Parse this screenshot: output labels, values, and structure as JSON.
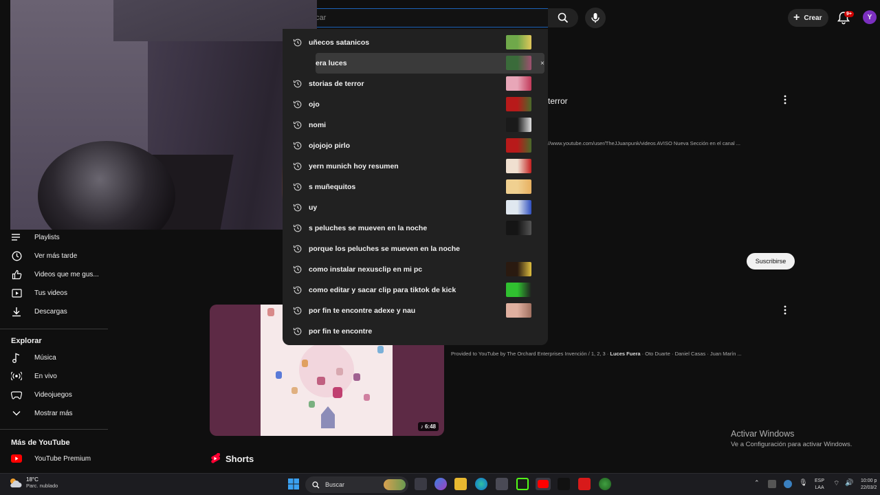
{
  "header": {
    "search_value": "car",
    "create_label": "Crear",
    "notif_badge": "9+",
    "avatar_letter": "Y"
  },
  "suggestions": [
    {
      "text": "uñecos satanicos",
      "thumb": [
        "#6fa84a",
        "#e0c75a"
      ]
    },
    {
      "text": "era luces",
      "thumb": [
        "#3a6b3a",
        "#a05070"
      ],
      "highlighted": true
    },
    {
      "text": "storias de terror",
      "thumb": [
        "#e8a6b8",
        "#c23a5a"
      ]
    },
    {
      "text": "ojo",
      "thumb": [
        "#b81a1a",
        "#4a6b2a"
      ]
    },
    {
      "text": "nomi",
      "thumb": [
        "#1a1a1a",
        "#e0e0e0"
      ]
    },
    {
      "text": "ojojojo pirlo",
      "thumb": [
        "#b81a1a",
        "#4a6b2a"
      ]
    },
    {
      "text": "yern munich hoy resumen",
      "thumb": [
        "#f0e0d0",
        "#c42020"
      ]
    },
    {
      "text": "s muñequitos",
      "thumb": [
        "#f0d090",
        "#e8b060"
      ]
    },
    {
      "text": "uy",
      "thumb": [
        "#e0e8f0",
        "#3050c0"
      ]
    },
    {
      "text": "s peluches se mueven en la noche",
      "thumb": [
        "#151515",
        "#555555"
      ]
    },
    {
      "text": "porque los peluches se mueven en la noche",
      "thumb": null
    },
    {
      "text": "como instalar nexusclip en mi pc",
      "thumb": [
        "#2a1a10",
        "#e0c040"
      ]
    },
    {
      "text": "como editar y sacar clip para tiktok de kick",
      "thumb": [
        "#30c030",
        "#202020"
      ]
    },
    {
      "text": "por fin te encontre adexe y nau",
      "thumb": [
        "#e0b0a0",
        "#a07060"
      ]
    },
    {
      "text": "por fin te encontre",
      "thumb": null
    }
  ],
  "remove_symbol": "×",
  "sidebar": {
    "items_top": [
      {
        "label": "Playlists",
        "icon": "playlist-icon"
      },
      {
        "label": "Ver más tarde",
        "icon": "clock-icon"
      },
      {
        "label": "Videos que me gus...",
        "icon": "thumbs-up-icon"
      },
      {
        "label": "Tus videos",
        "icon": "play-square-icon"
      },
      {
        "label": "Descargas",
        "icon": "download-icon"
      }
    ],
    "explore_title": "Explorar",
    "explore_items": [
      {
        "label": "Música",
        "icon": "music-icon"
      },
      {
        "label": "En vivo",
        "icon": "live-icon"
      },
      {
        "label": "Videojuegos",
        "icon": "gamepad-icon"
      },
      {
        "label": "Mostrar más",
        "icon": "chevron-down-icon"
      }
    ],
    "more_title": "Más de YouTube",
    "premium_label": "YouTube Premium"
  },
  "main": {
    "terror_text": "terror",
    "url_text": "//www.youtube.com/user/TheJJuanpunk/videos AVISO Nueva Sección en el canal ...",
    "subscribe_label": "Suscribirse",
    "provided_prefix": "Provided to YouTube by The Orchard Enterprises Invención / 1, 2, 3 · ",
    "provided_bold": "Luces Fuera",
    "provided_suffix": " · Oto Duarte · Daniel Casas · Juan Marín ...",
    "duration": "6:48",
    "shorts_label": "Shorts"
  },
  "windows_activation": {
    "title": "Activar Windows",
    "subtitle": "Ve a Configuración para activar Windows."
  },
  "taskbar": {
    "temperature": "18°C",
    "condition": "Parc. nublado",
    "search_label": "Buscar",
    "lang_top": "ESP",
    "lang_bottom": "LAA",
    "time": "10:00 p",
    "date": "22/03/2"
  },
  "colors": {
    "accent_blue": "#1c62b9",
    "youtube_red": "#ff0000",
    "background": "#0f0f0f"
  }
}
